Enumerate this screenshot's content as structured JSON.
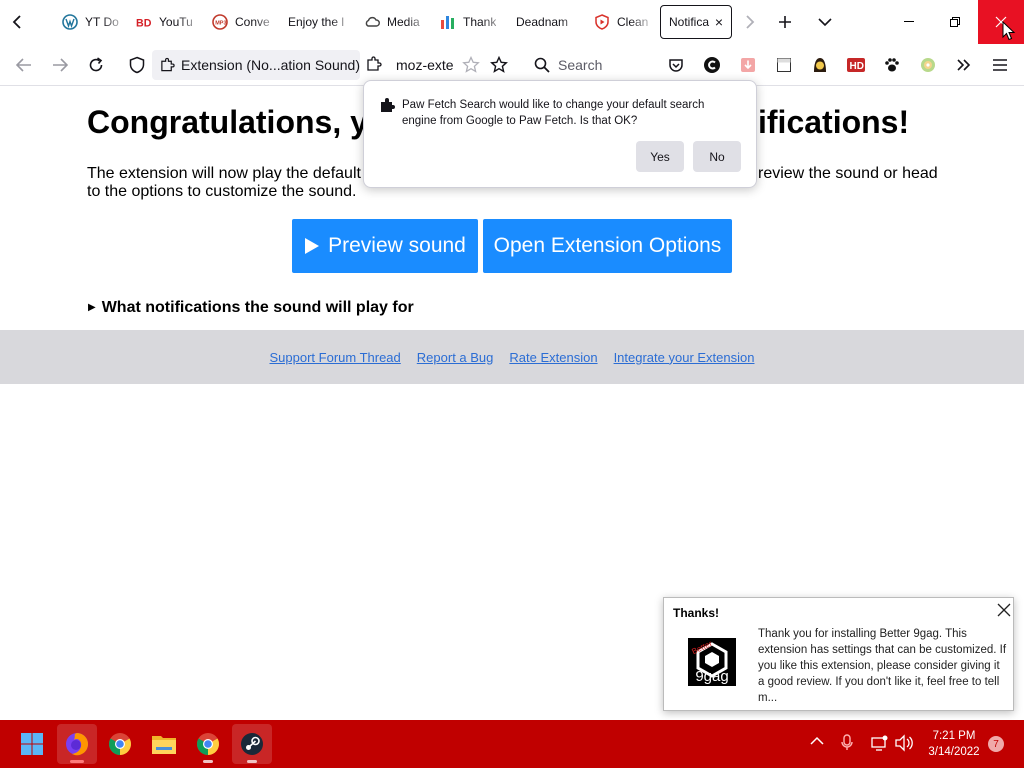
{
  "browser": {
    "tabs": [
      {
        "label": "YT Do",
        "icon": "wordpress-icon"
      },
      {
        "label": "YouTu",
        "icon": "bd-icon"
      },
      {
        "label": "Conve",
        "icon": "mp3-icon"
      },
      {
        "label": "Enjoy the l",
        "icon": "none"
      },
      {
        "label": "Media",
        "icon": "cloud-icon"
      },
      {
        "label": "Thank",
        "icon": "chart-icon"
      },
      {
        "label": "Deadnam",
        "icon": "none"
      },
      {
        "label": "Clean",
        "icon": "shield-play-icon"
      },
      {
        "label": "Notifica",
        "icon": "none",
        "selected": true
      }
    ],
    "close_tab_glyph": "×",
    "identity_label": "Extension (No...ation Sound)",
    "url": "moz-exte",
    "search_placeholder": "Search",
    "colors": {
      "accent": "#1a8cff",
      "close_hover": "#e81123",
      "taskbar": "#c00000",
      "footer_bg": "#d8d8dc"
    }
  },
  "page": {
    "headline": "Congratulations, y                                    ifications!",
    "headline_left": "Congratulations, y",
    "headline_right": "ifications!",
    "description_left": "The extension will now play the default",
    "description_right": "review the sound or head",
    "description_line2": "to the options to customize the sound.",
    "preview_button": "Preview sound",
    "options_button": "Open Extension Options",
    "details_summary": "What notifications the sound will play for",
    "footer_links": [
      "Support Forum Thread",
      "Report a Bug",
      "Rate Extension",
      "Integrate your Extension"
    ]
  },
  "doorhanger": {
    "message": "Paw Fetch Search would like to change your default search engine from Google to Paw Fetch. Is that OK?",
    "yes_label": "Yes",
    "no_label": "No"
  },
  "toast": {
    "title": "Thanks!",
    "body": "Thank you for installing Better 9gag. This extension has settings that can be customized. If you like this extension, please consider giving it a good review. If you don't like it, feel free to tell m...",
    "logo_text": "9gag"
  },
  "taskbar": {
    "time": "7:21 PM",
    "date": "3/14/2022",
    "notification_count": "7"
  }
}
